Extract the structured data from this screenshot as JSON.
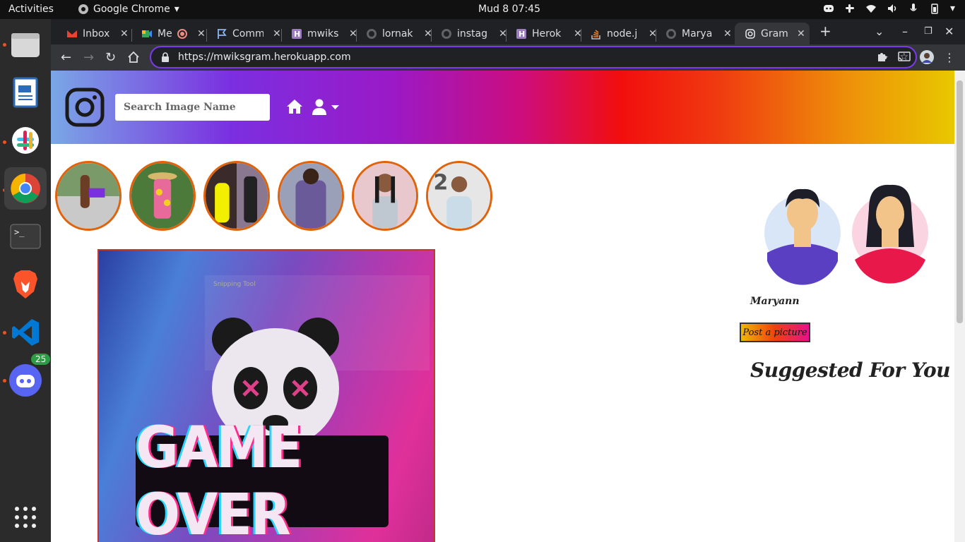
{
  "os_bar": {
    "activities": "Activities",
    "app_name": "Google Chrome",
    "clock": "Mud 8  07:45"
  },
  "dock": {
    "discord_badge": "25"
  },
  "browser": {
    "tabs": [
      {
        "label": "Inbox",
        "icon": "gmail-icon"
      },
      {
        "label": "Me",
        "icon": "meet-icon"
      },
      {
        "label": "Comm",
        "icon": "flag-icon"
      },
      {
        "label": "mwiks",
        "icon": "heroku-icon"
      },
      {
        "label": "lornak",
        "icon": "github-icon"
      },
      {
        "label": "instag",
        "icon": "github-icon"
      },
      {
        "label": "Herok",
        "icon": "heroku-icon"
      },
      {
        "label": "node.j",
        "icon": "stackoverflow-icon"
      },
      {
        "label": "Marya",
        "icon": "github-icon"
      },
      {
        "label": "Gram",
        "icon": "instagram-icon",
        "active": true
      }
    ],
    "url": "https://mwiksgram.herokuapp.com"
  },
  "page": {
    "search": {
      "placeholder": "Search Image Name"
    },
    "post": {
      "image_text": "GAME OVER",
      "snip_label": "Snipping Tool"
    },
    "sidebar": {
      "username": "Maryann",
      "post_button": "Post a picture",
      "suggested_heading": "Suggested For You"
    }
  },
  "colors": {
    "story_border": "#e0620a",
    "omnibox_focus": "#7c3aed"
  }
}
